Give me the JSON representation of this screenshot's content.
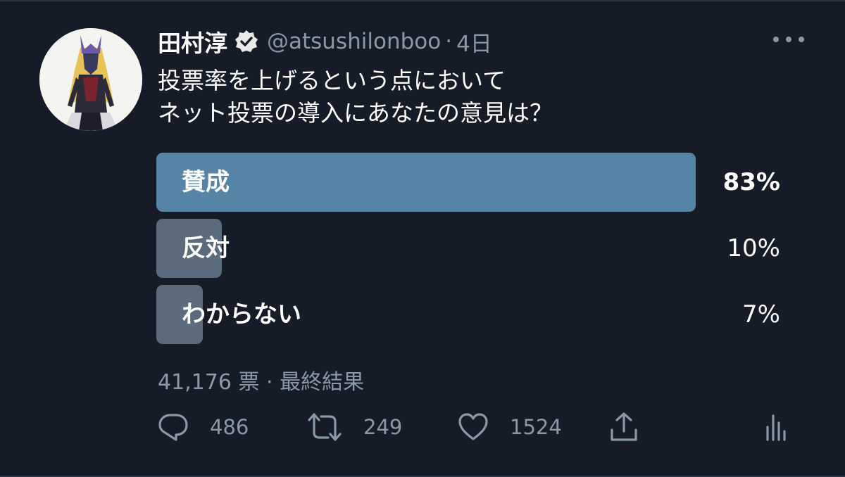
{
  "tweet": {
    "author_name": "田村淳",
    "handle": "@atsushilonboo",
    "separator": "·",
    "time": "4日",
    "text_line1": "投票率を上げるという点において",
    "text_line2": "ネット投票の導入にあなたの意見は？"
  },
  "poll": {
    "options": [
      {
        "label": "賛成",
        "percent_text": "83%",
        "percent": 83
      },
      {
        "label": "反対",
        "percent_text": "10%",
        "percent": 10
      },
      {
        "label": "わからない",
        "percent_text": "7%",
        "percent": 7
      }
    ],
    "meta": "41,176 票 · 最終結果"
  },
  "actions": {
    "reply_count": "486",
    "retweet_count": "249",
    "like_count": "1524"
  },
  "colors": {
    "background": "#151c28",
    "winner_bar": "#5584a7",
    "other_bar": "#5b6b7b",
    "secondary_text": "#8b98a5"
  }
}
